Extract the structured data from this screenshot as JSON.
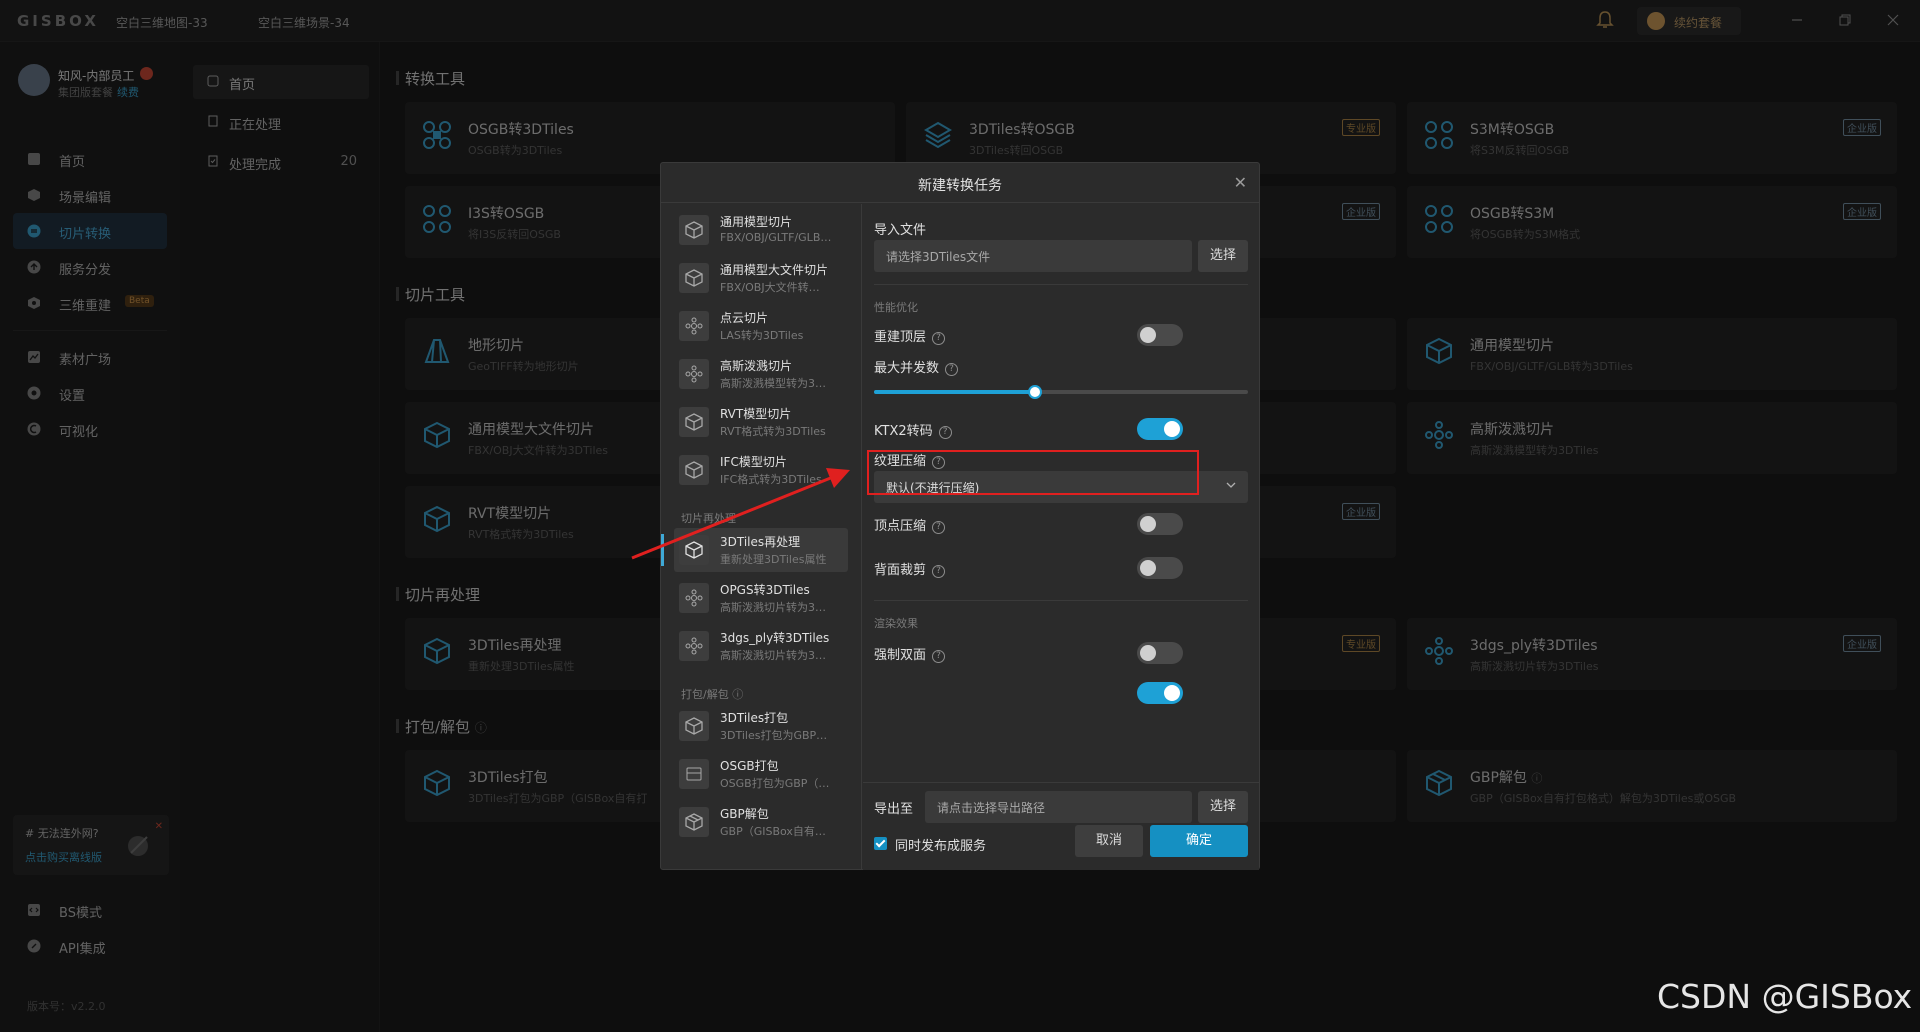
{
  "titlebar": {
    "logo": "GISBOX",
    "tabs": [
      "空白三维地图-33",
      "空白三维场景-34"
    ],
    "renew_label": "续约套餐"
  },
  "user": {
    "name": "知风-内部员工",
    "plan": "集团版套餐",
    "renew": "续费"
  },
  "nav": {
    "items": [
      {
        "label": "首页",
        "icon": "home-icon"
      },
      {
        "label": "场景编辑",
        "icon": "cube-icon"
      },
      {
        "label": "切片转换",
        "icon": "convert-icon",
        "active": true
      },
      {
        "label": "服务分发",
        "icon": "upload-icon"
      },
      {
        "label": "三维重建",
        "icon": "rebuild-icon",
        "badge": "Beta"
      },
      {
        "label": "素材广场",
        "icon": "chart-icon"
      },
      {
        "label": "设置",
        "icon": "gear-icon"
      },
      {
        "label": "可视化",
        "icon": "visual-icon"
      }
    ],
    "promo_title": "# 无法连外网?",
    "promo_link": "点击购买离线版",
    "bs_mode": "BS模式",
    "api": "API集成",
    "version": "版本号：v2.2.0"
  },
  "subnav": {
    "items": [
      {
        "label": "首页",
        "active": true
      },
      {
        "label": "正在处理"
      },
      {
        "label": "处理完成",
        "count": "20"
      }
    ]
  },
  "sections": {
    "convert": "转换工具",
    "slice": "切片工具",
    "reprocess": "切片再处理",
    "pack": "打包/解包"
  },
  "cards": [
    {
      "title": "OSGB转3DTiles",
      "desc": "OSGB转为3DTiles"
    },
    {
      "title": "3DTiles转OSGB",
      "desc": "3DTiles转回OSGB",
      "tag": "专业版"
    },
    {
      "title": "S3M转OSGB",
      "desc": "将S3M反转回OSGB",
      "tag": "企业版"
    },
    {
      "title": "I3S转OSGB",
      "desc": "将I3S反转回OSGB"
    },
    {
      "title": "OSGB转S3M",
      "desc": "将OSGB转为S3M格式",
      "tag": "企业版"
    },
    {
      "title": "地形切片",
      "desc": "GeoTIFF转为地形切片"
    },
    {
      "title": "通用模型切片",
      "desc": "FBX/OBJ/GLTF/GLB转为3DTiles"
    },
    {
      "title": "通用模型大文件切片",
      "desc": "FBX/OBJ大文件转为3DTiles"
    },
    {
      "title": "高斯泼溅切片",
      "desc": "高斯泼溅模型转为3DTiles"
    },
    {
      "title": "RVT模型切片",
      "desc": "RVT格式转为3DTiles"
    },
    {
      "title": "3DTiles再处理",
      "desc": "重新处理3DTiles属性"
    },
    {
      "title": "3dgs_ply转3DTiles",
      "desc": "高斯泼溅切片转为3DTiles",
      "tag": "企业版"
    },
    {
      "title": "3DTiles打包",
      "desc": "3DTiles打包为GBP（GISBox自有打"
    },
    {
      "title": "GBP解包",
      "desc": "GBP（GISBox自有打包格式）解包为3DTiles或OSGB"
    }
  ],
  "hidden_tags": {
    "slice_ent": "企业版",
    "reprocess_pro": "专业版"
  },
  "modal": {
    "title": "新建转换任务",
    "list": [
      {
        "title": "通用模型切片",
        "desc": "FBX/OBJ/GLTF/GLB…"
      },
      {
        "title": "通用模型大文件切片",
        "desc": "FBX/OBJ大文件转…"
      },
      {
        "title": "点云切片",
        "desc": "LAS转为3DTiles"
      },
      {
        "title": "高斯泼溅切片",
        "desc": "高斯泼溅模型转为3…"
      },
      {
        "title": "RVT模型切片",
        "desc": "RVT格式转为3DTiles"
      },
      {
        "title": "IFC模型切片",
        "desc": "IFC格式转为3DTiles"
      },
      {
        "title": "3DTiles再处理",
        "desc": "重新处理3DTiles属性",
        "active": true
      },
      {
        "title": "OPGS转3DTiles",
        "desc": "高斯泼溅切片转为3…"
      },
      {
        "title": "3dgs_ply转3DTiles",
        "desc": "高斯泼溅切片转为3…"
      },
      {
        "title": "3DTiles打包",
        "desc": "3DTiles打包为GBP…"
      },
      {
        "title": "OSGB打包",
        "desc": "OSGB打包为GBP（…"
      },
      {
        "title": "GBP解包",
        "desc": "GBP（GISBox自有…"
      }
    ],
    "group_reprocess": "切片再处理",
    "group_pack": "打包/解包",
    "import_label": "导入文件",
    "import_placeholder": "请选择3DTiles文件",
    "select_btn": "选择",
    "perf_group": "性能优化",
    "rebuild_top": "重建顶层",
    "max_concurrency": "最大并发数",
    "concurrency_level": 0.43,
    "ktx2": "KTX2转码",
    "texture_compress": "纹理压缩",
    "texture_value": "默认(不进行压缩)",
    "vertex_compress": "顶点压缩",
    "backface_cull": "背面裁剪",
    "render_group": "渲染效果",
    "double_side": "强制双面",
    "export_label": "导出至",
    "export_placeholder": "请点击选择导出路径",
    "publish_label": "同时发布成服务",
    "cancel": "取消",
    "ok": "确定"
  },
  "watermark": "CSDN @GISBox",
  "colors": {
    "accent": "#1ea1d6",
    "highlight": "#e0201f",
    "primary_btn": "#1590c2"
  }
}
